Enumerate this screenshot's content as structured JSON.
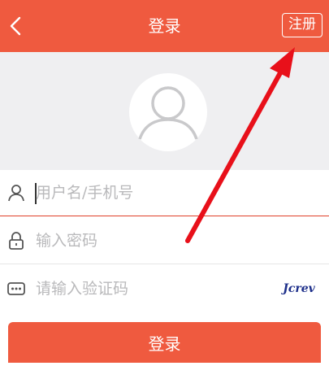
{
  "header": {
    "title": "登录",
    "register_label": "注册",
    "back_icon": "chevron-left-icon"
  },
  "avatar": {
    "icon": "user-avatar-icon"
  },
  "form": {
    "username_placeholder": "用户名/手机号",
    "password_placeholder": "输入密码",
    "captcha_placeholder": "请输入验证码",
    "captcha_text": "Jcrev"
  },
  "login_button_label": "登录",
  "colors": {
    "accent": "#ef5a3f",
    "annotation_arrow": "#e8101a"
  }
}
